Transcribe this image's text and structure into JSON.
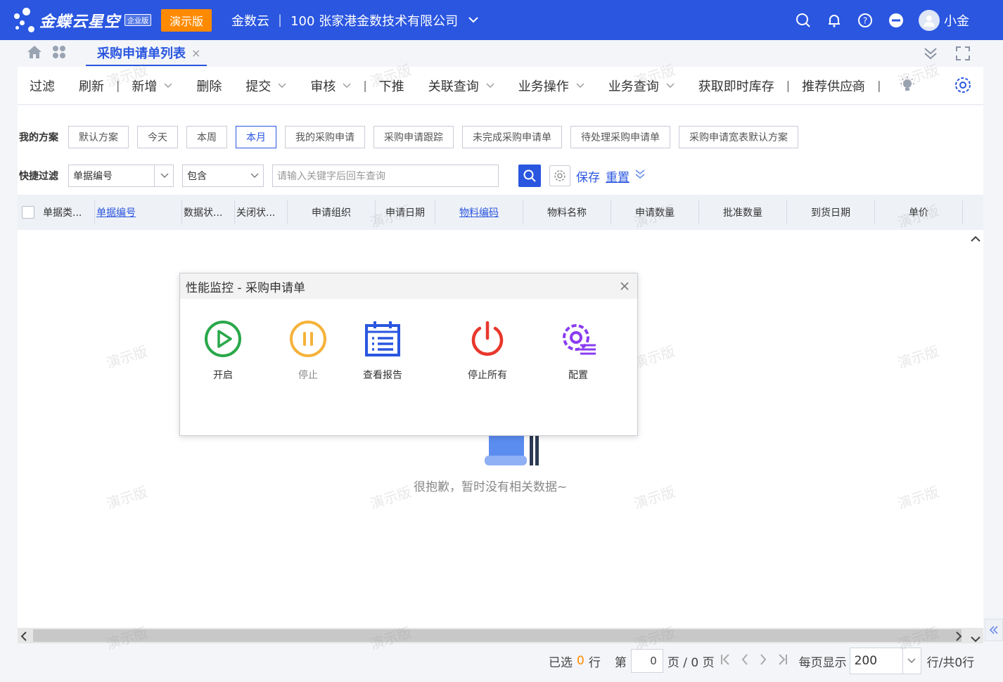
{
  "topbar": {
    "brand": "金蝶云星空",
    "edition": "企业版",
    "demo_badge": "演示版",
    "tenant": "金数云",
    "company": "100 张家港金数技术有限公司",
    "user_name": "小金",
    "icons": [
      "search-icon",
      "bell-icon",
      "help-icon",
      "minus-circle-icon",
      "avatar"
    ]
  },
  "tabs": {
    "active_label": "采购申请单列表",
    "close_glyph": "×"
  },
  "toolbar": {
    "items": [
      {
        "label": "过滤",
        "dropdown": false,
        "sep": false
      },
      {
        "label": "刷新",
        "dropdown": false,
        "sep": true
      },
      {
        "label": "新增",
        "dropdown": true,
        "sep": false
      },
      {
        "label": "删除",
        "dropdown": false,
        "sep": false
      },
      {
        "label": "提交",
        "dropdown": true,
        "sep": false
      },
      {
        "label": "审核",
        "dropdown": true,
        "sep": true
      },
      {
        "label": "下推",
        "dropdown": false,
        "sep": false
      },
      {
        "label": "关联查询",
        "dropdown": true,
        "sep": false
      },
      {
        "label": "业务操作",
        "dropdown": true,
        "sep": false
      },
      {
        "label": "业务查询",
        "dropdown": true,
        "sep": false
      },
      {
        "label": "获取即时库存",
        "dropdown": false,
        "sep": true
      },
      {
        "label": "推荐供应商",
        "dropdown": false,
        "sep": true
      }
    ]
  },
  "schemes": {
    "label": "我的方案",
    "buttons": [
      "默认方案",
      "今天",
      "本周",
      "本月",
      "我的采购申请",
      "采购申请跟踪",
      "未完成采购申请单",
      "待处理采购申请单",
      "采购申请宽表默认方案"
    ],
    "active": "本月"
  },
  "quick_filter": {
    "label": "快捷过滤",
    "field": "单据编号",
    "operator": "包含",
    "placeholder": "请输入关键字后回车查询",
    "save": "保存",
    "reset": "重置"
  },
  "grid": {
    "columns": [
      {
        "label": "单据类...",
        "link": false
      },
      {
        "label": "单据编号",
        "link": true
      },
      {
        "label": "数据状...",
        "link": false
      },
      {
        "label": "关闭状...",
        "link": false
      },
      {
        "label": "申请组织",
        "link": false
      },
      {
        "label": "申请日期",
        "link": false
      },
      {
        "label": "物料编码",
        "link": true
      },
      {
        "label": "物料名称",
        "link": false
      },
      {
        "label": "申请数量",
        "link": false
      },
      {
        "label": "批准数量",
        "link": false
      },
      {
        "label": "到货日期",
        "link": false
      },
      {
        "label": "单价",
        "link": false
      }
    ],
    "empty_text": "很抱歉，暂时没有相关数据~"
  },
  "footer": {
    "selected_prefix": "已选",
    "selected_count": "0",
    "selected_suffix": "行",
    "page_prefix": "第",
    "page_value": "0",
    "page_suffix": "页 / 0 页",
    "page_size_label": "每页显示",
    "page_size": "200",
    "total": "行/共0行"
  },
  "dialog": {
    "title": "性能监控 - 采购申请单",
    "items": [
      {
        "label": "开启",
        "icon": "play-circle-icon",
        "color": "#2aa84a"
      },
      {
        "label": "停止",
        "icon": "pause-circle-icon",
        "color": "#f5b23a"
      },
      {
        "label": "查看报告",
        "icon": "calendar-list-icon",
        "color": "#2a56e0"
      },
      {
        "label": "停止所有",
        "icon": "power-icon",
        "color": "#e8382c"
      },
      {
        "label": "配置",
        "icon": "gear-list-icon",
        "color": "#8a3cf0"
      }
    ]
  },
  "watermark": "演示版"
}
